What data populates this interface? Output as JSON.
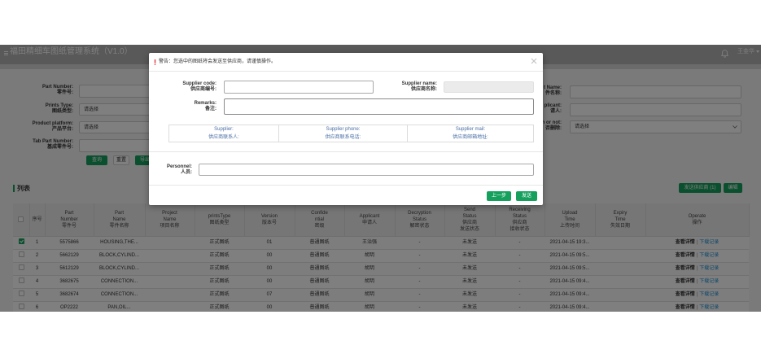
{
  "colors": {
    "accent": "#16a05d",
    "warning": "#e53935",
    "link": "#1b8fd6",
    "modal_header_text": "#4a6fa5"
  },
  "app": {
    "title": "福田精细车图纸管理系统（V1.0）",
    "user_name": "王金华",
    "icons": {
      "menu": "menu-icon",
      "notifications": "bell-icon",
      "user_menu": "chevron-down-icon"
    }
  },
  "search": {
    "left": [
      {
        "label_en": "Part Number:",
        "label_zh": "零件号:",
        "value": ""
      },
      {
        "label_en": "Prints Type:",
        "label_zh": "图纸类型:",
        "value": "请选择"
      },
      {
        "label_en": "Product platform:",
        "label_zh": "产品平台:",
        "value": "请选择"
      },
      {
        "label_en": "Tab Part Number:",
        "label_zh": "基成零件号:",
        "value": ""
      }
    ],
    "right": [
      {
        "label_en": "t Name:",
        "label_zh": "件名称:",
        "value": ""
      },
      {
        "label_en": "plicant:",
        "label_zh": "请人:",
        "value": ""
      },
      {
        "label_en": "n or not:",
        "label_zh": "否删除:",
        "value": "请选择"
      }
    ],
    "query_button": "查询",
    "reset_button": "重置",
    "export_button": "导出"
  },
  "list": {
    "title": "列表",
    "send_supplier_button": "发送供应商 (1)",
    "edit_button": "编辑",
    "columns": [
      {
        "key": "select",
        "lines": []
      },
      {
        "key": "no",
        "lines": [
          "序号"
        ]
      },
      {
        "key": "part_number",
        "lines": [
          "Part",
          "Number",
          "零件号"
        ]
      },
      {
        "key": "part_name",
        "lines": [
          "Part",
          "Name",
          "零件名称"
        ]
      },
      {
        "key": "project_name",
        "lines": [
          "Project",
          "Name",
          "项目名称"
        ]
      },
      {
        "key": "prints_type",
        "lines": [
          "printsType",
          "图纸类型"
        ]
      },
      {
        "key": "version",
        "lines": [
          "Version",
          "版本号"
        ]
      },
      {
        "key": "confidentiality",
        "lines": [
          "Confide",
          "ntial",
          "密级"
        ]
      },
      {
        "key": "applicant",
        "lines": [
          "Applicant",
          "申请人"
        ]
      },
      {
        "key": "decryption_status",
        "lines": [
          "Decryption",
          "Status",
          "解密状态"
        ]
      },
      {
        "key": "send_status",
        "lines": [
          "Send",
          "Status",
          "供应商",
          "发送状态"
        ]
      },
      {
        "key": "receiving_status",
        "lines": [
          "Receiving",
          "Status",
          "供应商",
          "接收状态"
        ]
      },
      {
        "key": "upload_time",
        "lines": [
          "Upload",
          "Time",
          "上传时间"
        ]
      },
      {
        "key": "expiry_time",
        "lines": [
          "Expiry",
          "Time",
          "失效日期"
        ]
      },
      {
        "key": "operate",
        "lines": [
          "Operate",
          "操作"
        ]
      }
    ],
    "rows": [
      {
        "checked": true,
        "no": "1",
        "part_number": "5575866",
        "part_name": "HOUSING,THE...",
        "project_name": "",
        "prints_type": "正式图纸",
        "version": "01",
        "confidentiality": "普通图纸",
        "applicant": "王治强",
        "decryption_status": "-",
        "send_status": "未发送",
        "receiving_status": "-",
        "upload_time": "2021-04-15 19:3...",
        "expiry_time": "",
        "operate": {
          "detail_link": "查看详情",
          "separator": "|",
          "download_link": "下载记录"
        }
      },
      {
        "checked": false,
        "no": "2",
        "part_number": "5662129",
        "part_name": "BLOCK,CYLIND...",
        "project_name": "",
        "prints_type": "正式图纸",
        "version": "00",
        "confidentiality": "普通图纸",
        "applicant": "胡玥",
        "decryption_status": "-",
        "send_status": "未发送",
        "receiving_status": "-",
        "upload_time": "2021-04-15 09:5...",
        "expiry_time": "",
        "operate": {
          "detail_link": "查看详情",
          "separator": "|",
          "download_link": "下载记录"
        }
      },
      {
        "checked": false,
        "no": "3",
        "part_number": "5612129",
        "part_name": "BLOCK,CYLIND...",
        "project_name": "",
        "prints_type": "正式图纸",
        "version": "00",
        "confidentiality": "普通图纸",
        "applicant": "胡玥",
        "decryption_status": "-",
        "send_status": "未发送",
        "receiving_status": "-",
        "upload_time": "2021-04-15 09:5...",
        "expiry_time": "",
        "operate": {
          "detail_link": "查看详情",
          "separator": "|",
          "download_link": "下载记录"
        }
      },
      {
        "checked": false,
        "no": "4",
        "part_number": "3682675",
        "part_name": "CONNECTION...",
        "project_name": "",
        "prints_type": "正式图纸",
        "version": "00",
        "confidentiality": "普通图纸",
        "applicant": "胡玥",
        "decryption_status": "-",
        "send_status": "未发送",
        "receiving_status": "-",
        "upload_time": "2021-04-15 09:4...",
        "expiry_time": "",
        "operate": {
          "detail_link": "查看详情",
          "separator": "|",
          "download_link": "下载记录"
        }
      },
      {
        "checked": false,
        "no": "5",
        "part_number": "3682674",
        "part_name": "CONNECTION...",
        "project_name": "",
        "prints_type": "正式图纸",
        "version": "07",
        "confidentiality": "普通图纸",
        "applicant": "胡玥",
        "decryption_status": "-",
        "send_status": "未发送",
        "receiving_status": "-",
        "upload_time": "2021-04-15 09:4...",
        "expiry_time": "",
        "operate": {
          "detail_link": "查看详情",
          "separator": "|",
          "download_link": "下载记录"
        }
      },
      {
        "checked": false,
        "no": "6",
        "part_number": "OP2222",
        "part_name": "PAN,OIL...",
        "project_name": "",
        "prints_type": "正式图纸",
        "version": "00",
        "confidentiality": "普通图纸",
        "applicant": "胡玥",
        "decryption_status": "-",
        "send_status": "未发送",
        "receiving_status": "-",
        "upload_time": "2021-04-15 09:4...",
        "expiry_time": "",
        "operate": {
          "detail_link": "查看详情",
          "separator": "|",
          "download_link": "下载记录"
        }
      }
    ]
  },
  "modal": {
    "warning": "警告：您选中的图纸将会发送至供应商，请谨慎操作。",
    "icons": {
      "warning": "exclamation-icon",
      "close": "close-icon"
    },
    "supplier_code": {
      "label_en": "Supplier code:",
      "label_zh": "供应商编号:",
      "value": ""
    },
    "supplier_name": {
      "label_en": "Supplier name:",
      "label_zh": "供应商名称:",
      "value": ""
    },
    "remarks": {
      "label_en": "Remarks:",
      "label_zh": "备注:",
      "value": ""
    },
    "contact_columns": [
      {
        "en": "Supplier:",
        "zh": "供应商联系人:"
      },
      {
        "en": "Supplier phone:",
        "zh": "供应商联系电话:"
      },
      {
        "en": "Supplier mail:",
        "zh": "供应商邮箱地址:"
      }
    ],
    "personnel": {
      "label_en": "Personnel:",
      "label_zh": "人员:",
      "value": ""
    },
    "prev_button": "上一步",
    "send_button": "发送"
  }
}
